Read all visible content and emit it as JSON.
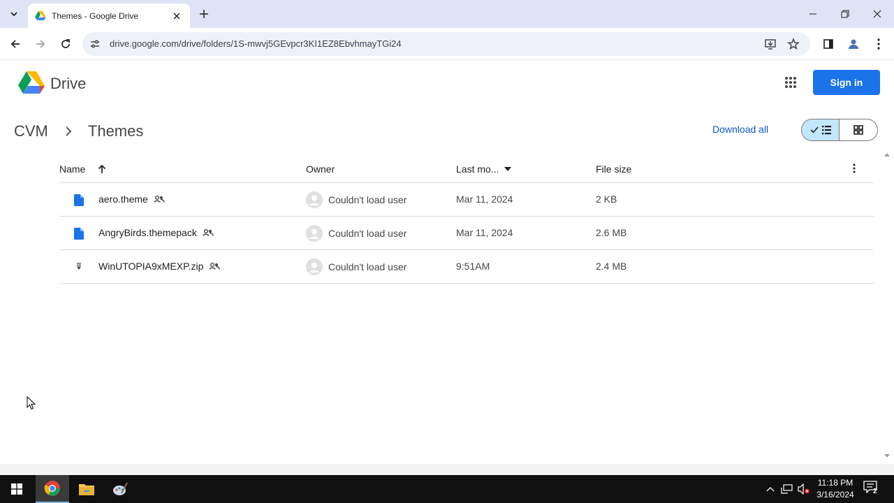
{
  "browser": {
    "tab_title": "Themes - Google Drive",
    "url": "drive.google.com/drive/folders/1S-mwvj5GEvpcr3KI1EZ8EbvhmayTGi24"
  },
  "drive": {
    "app_name": "Drive",
    "sign_in": "Sign in"
  },
  "breadcrumb": {
    "parent": "CVM",
    "current": "Themes"
  },
  "actions": {
    "download_all": "Download all"
  },
  "columns": {
    "name": "Name",
    "owner": "Owner",
    "last_modified": "Last mo...",
    "file_size": "File size"
  },
  "files": [
    {
      "name": "aero.theme",
      "owner": "Couldn't load user",
      "modified": "Mar 11, 2024",
      "size": "2 KB",
      "icon": "document-icon"
    },
    {
      "name": "AngryBirds.themepack",
      "owner": "Couldn't load user",
      "modified": "Mar 11, 2024",
      "size": "2.6 MB",
      "icon": "document-icon"
    },
    {
      "name": "WinUTOPIA9xMEXP.zip",
      "owner": "Couldn't load user",
      "modified": "9:51AM",
      "size": "2.4 MB",
      "icon": "zip-icon"
    }
  ],
  "taskbar": {
    "time": "11:18 PM",
    "date": "3/16/2024",
    "notification_count": "2"
  },
  "colors": {
    "accent": "#1a73e8",
    "link": "#0b57d0",
    "tab_strip": "#dee3f5",
    "toggle_active": "#c2e7ff"
  }
}
